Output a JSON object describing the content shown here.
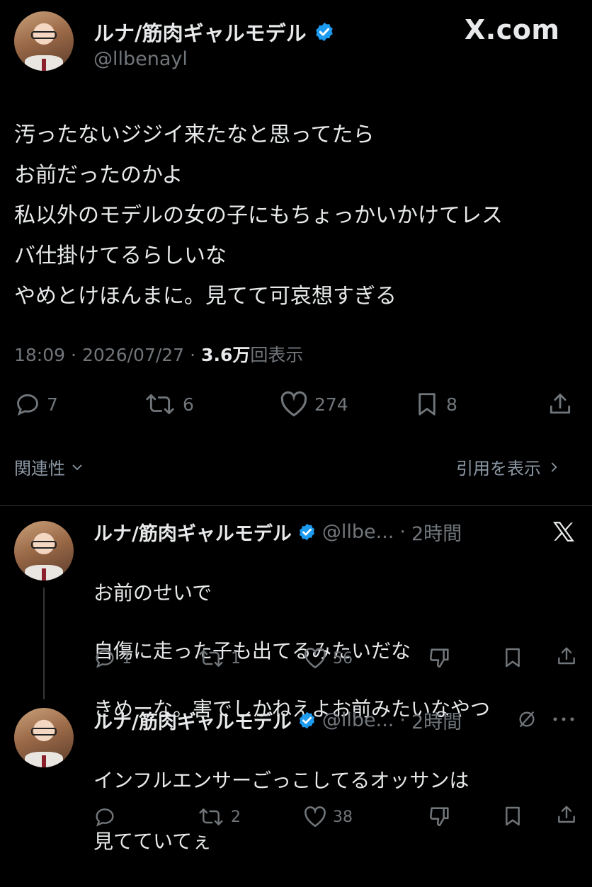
{
  "watermark": "X.com",
  "main_tweet": {
    "name": "ルナ/筋肉ギャルモデル",
    "handle": "@llbenayl",
    "lines": [
      "汚ったないジジイ来たなと思ってたら",
      "お前だったのかよ",
      "私以外のモデルの女の子にもちょっかいかけてレス",
      "バ仕掛けてるらしいな",
      "やめとけほんまに。見てて可哀想すぎる"
    ],
    "time": "18:09",
    "date": "2026/07/27",
    "views_count": "3.6万",
    "views_label": "回表示",
    "sep": "·",
    "stats": {
      "replies": "7",
      "reposts": "6",
      "likes": "274",
      "bookmarks": "8"
    }
  },
  "related_label": "関連性",
  "quotes_label": "引用を表示",
  "replies": [
    {
      "name": "ルナ/筋肉ギャルモデル",
      "handle": "@llbe...",
      "sep": "·",
      "time": "2時間",
      "lines": [
        "お前のせいで",
        "自傷に走った子も出てるみたいだな",
        "きめーな。害でしかねえよお前みたいなやつ"
      ],
      "stats": {
        "replies": "1",
        "reposts": "1",
        "likes": "56"
      }
    },
    {
      "name": "ルナ/筋肉ギャルモデル",
      "handle": "@llbe...",
      "sep": "·",
      "time": "2時間",
      "lines": [
        "インフルエンサーごっこしてるオッサンは",
        "見てていてぇ"
      ],
      "stats": {
        "replies": "",
        "reposts": "2",
        "likes": "38"
      }
    }
  ],
  "colors": {
    "background": "#000000",
    "text": "#e7e9ea",
    "muted": "#71767b",
    "verified": "#1d9bf0"
  }
}
